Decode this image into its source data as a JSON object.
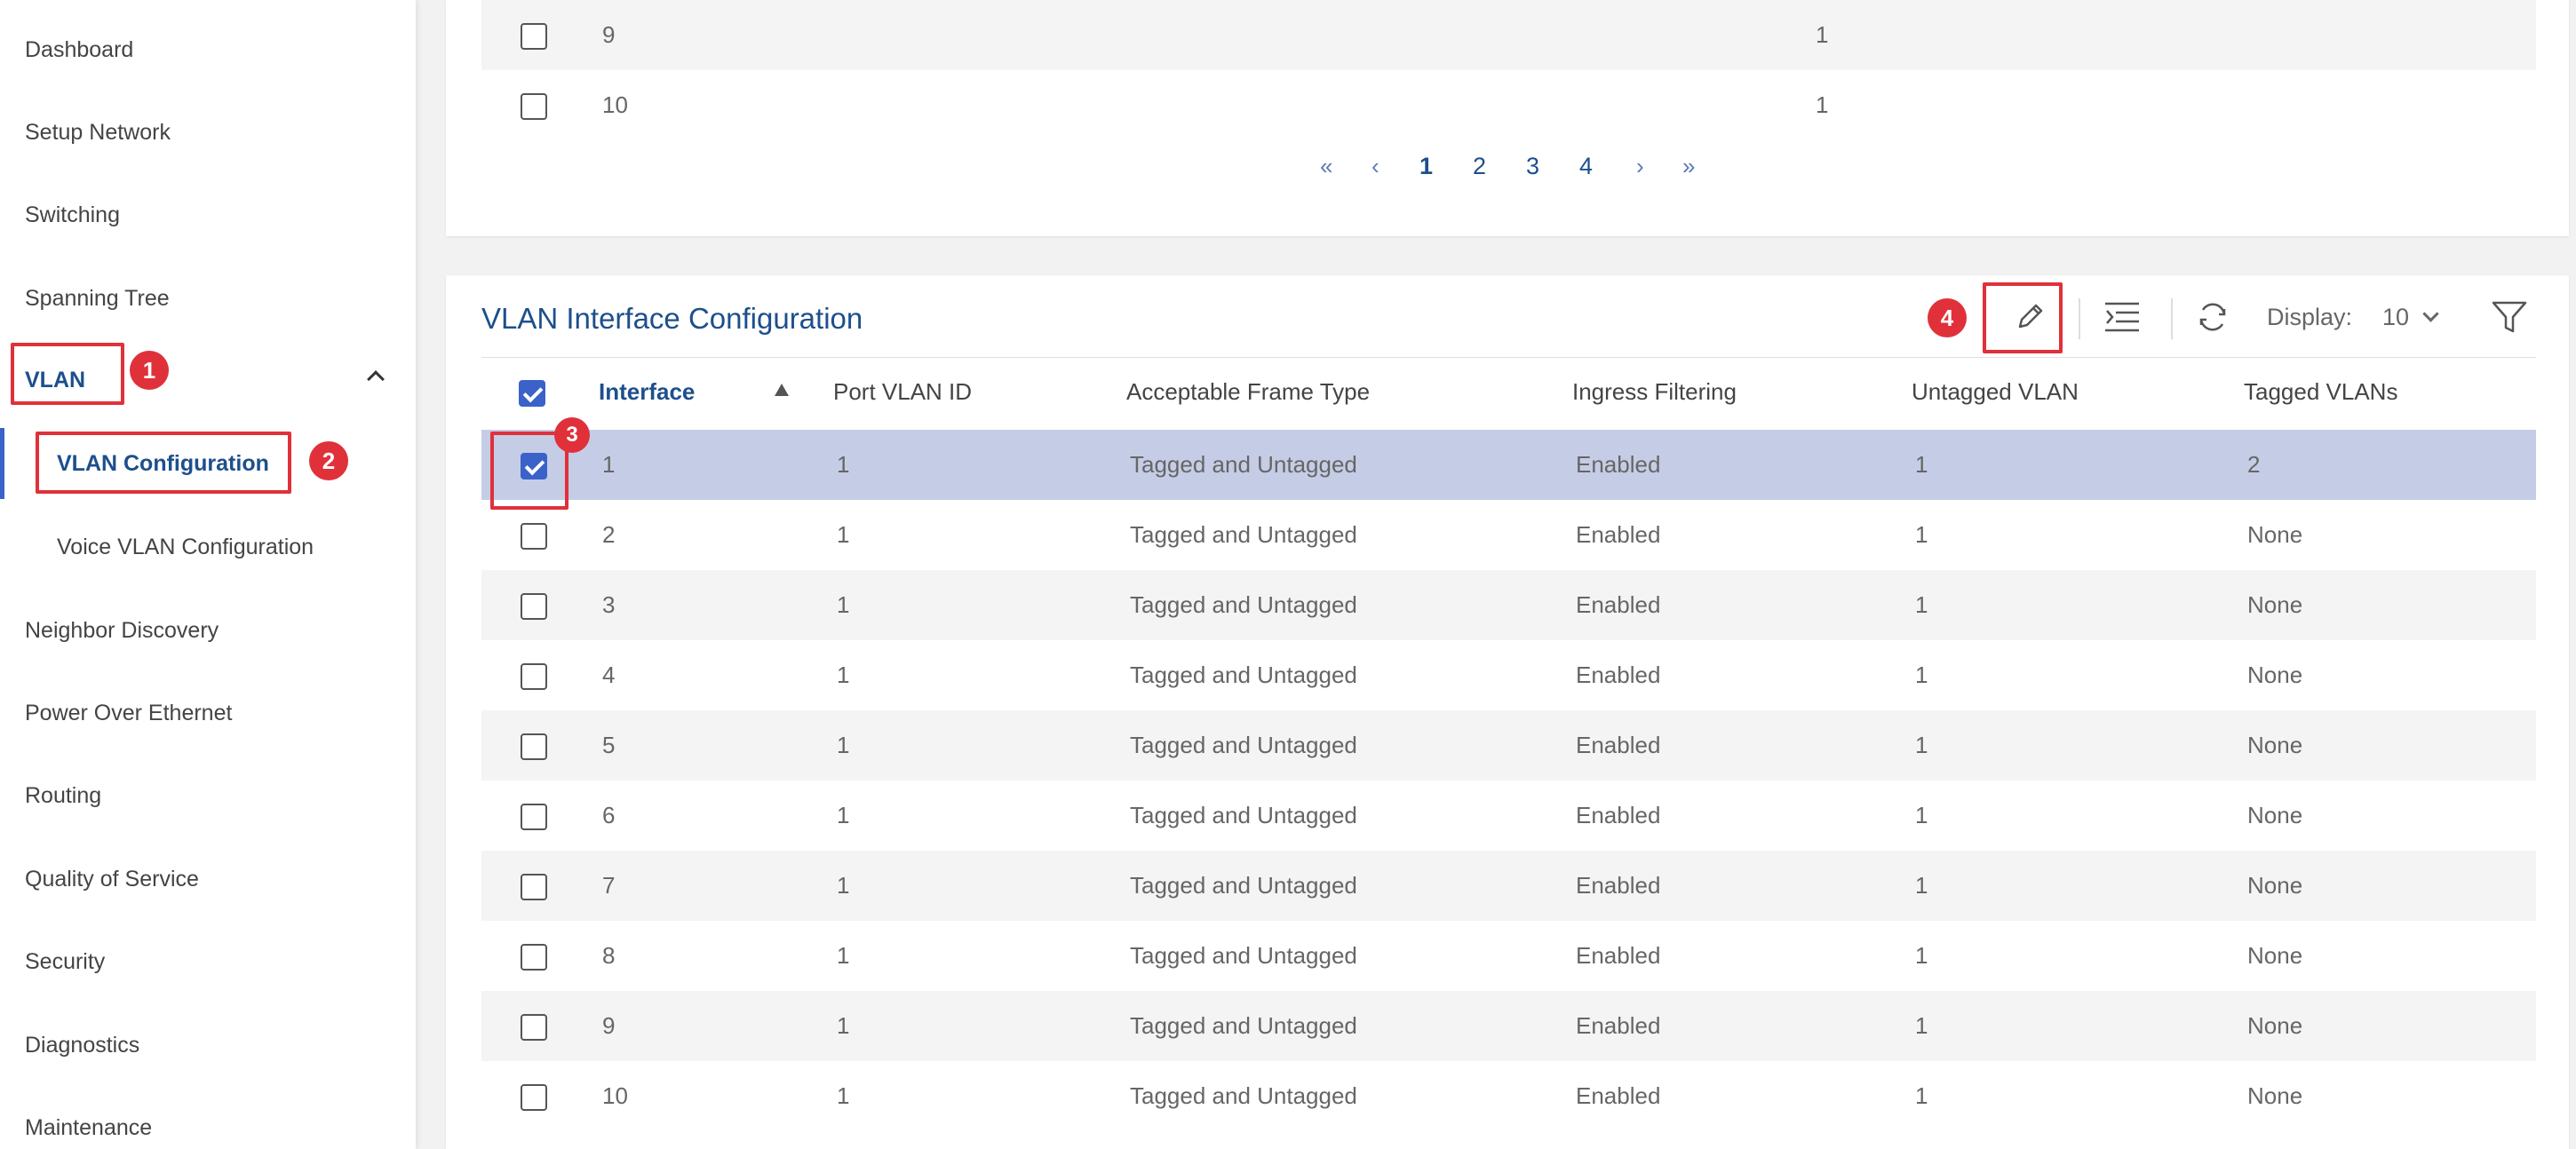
{
  "sidebar": {
    "items": [
      {
        "label": "Dashboard"
      },
      {
        "label": "Setup Network"
      },
      {
        "label": "Switching"
      },
      {
        "label": "Spanning Tree"
      },
      {
        "label": "VLAN"
      },
      {
        "label": "VLAN Configuration"
      },
      {
        "label": "Voice VLAN Configuration"
      },
      {
        "label": "Neighbor Discovery"
      },
      {
        "label": "Power Over Ethernet"
      },
      {
        "label": "Routing"
      },
      {
        "label": "Quality of Service"
      },
      {
        "label": "Security"
      },
      {
        "label": "Diagnostics"
      },
      {
        "label": "Maintenance"
      }
    ]
  },
  "annotations": [
    "1",
    "2",
    "3",
    "4"
  ],
  "top_panel": {
    "rows": [
      {
        "interface": "9",
        "value": "1"
      },
      {
        "interface": "10",
        "value": "1"
      }
    ],
    "pagination": [
      "«",
      "‹",
      "1",
      "2",
      "3",
      "4",
      "›",
      "»"
    ]
  },
  "main_panel": {
    "title": "VLAN Interface Configuration",
    "display_label": "Display:",
    "display_value": "10",
    "columns": [
      "Interface",
      "Port VLAN ID",
      "Acceptable Frame Type",
      "Ingress Filtering",
      "Untagged VLAN",
      "Tagged VLANs"
    ],
    "rows": [
      {
        "interface": "1",
        "pvid": "1",
        "frame": "Tagged and Untagged",
        "ingress": "Enabled",
        "untagged": "1",
        "tagged": "2"
      },
      {
        "interface": "2",
        "pvid": "1",
        "frame": "Tagged and Untagged",
        "ingress": "Enabled",
        "untagged": "1",
        "tagged": "None"
      },
      {
        "interface": "3",
        "pvid": "1",
        "frame": "Tagged and Untagged",
        "ingress": "Enabled",
        "untagged": "1",
        "tagged": "None"
      },
      {
        "interface": "4",
        "pvid": "1",
        "frame": "Tagged and Untagged",
        "ingress": "Enabled",
        "untagged": "1",
        "tagged": "None"
      },
      {
        "interface": "5",
        "pvid": "1",
        "frame": "Tagged and Untagged",
        "ingress": "Enabled",
        "untagged": "1",
        "tagged": "None"
      },
      {
        "interface": "6",
        "pvid": "1",
        "frame": "Tagged and Untagged",
        "ingress": "Enabled",
        "untagged": "1",
        "tagged": "None"
      },
      {
        "interface": "7",
        "pvid": "1",
        "frame": "Tagged and Untagged",
        "ingress": "Enabled",
        "untagged": "1",
        "tagged": "None"
      },
      {
        "interface": "8",
        "pvid": "1",
        "frame": "Tagged and Untagged",
        "ingress": "Enabled",
        "untagged": "1",
        "tagged": "None"
      },
      {
        "interface": "9",
        "pvid": "1",
        "frame": "Tagged and Untagged",
        "ingress": "Enabled",
        "untagged": "1",
        "tagged": "None"
      },
      {
        "interface": "10",
        "pvid": "1",
        "frame": "Tagged and Untagged",
        "ingress": "Enabled",
        "untagged": "1",
        "tagged": "None"
      }
    ]
  },
  "icons": [
    "edit-icon",
    "column-select-icon",
    "refresh-icon",
    "filter-icon"
  ],
  "colors": {
    "accent": "#1d4f8c",
    "highlight": "#e0313b",
    "selected_row": "#c5cde6",
    "checkbox": "#3a62c8"
  }
}
